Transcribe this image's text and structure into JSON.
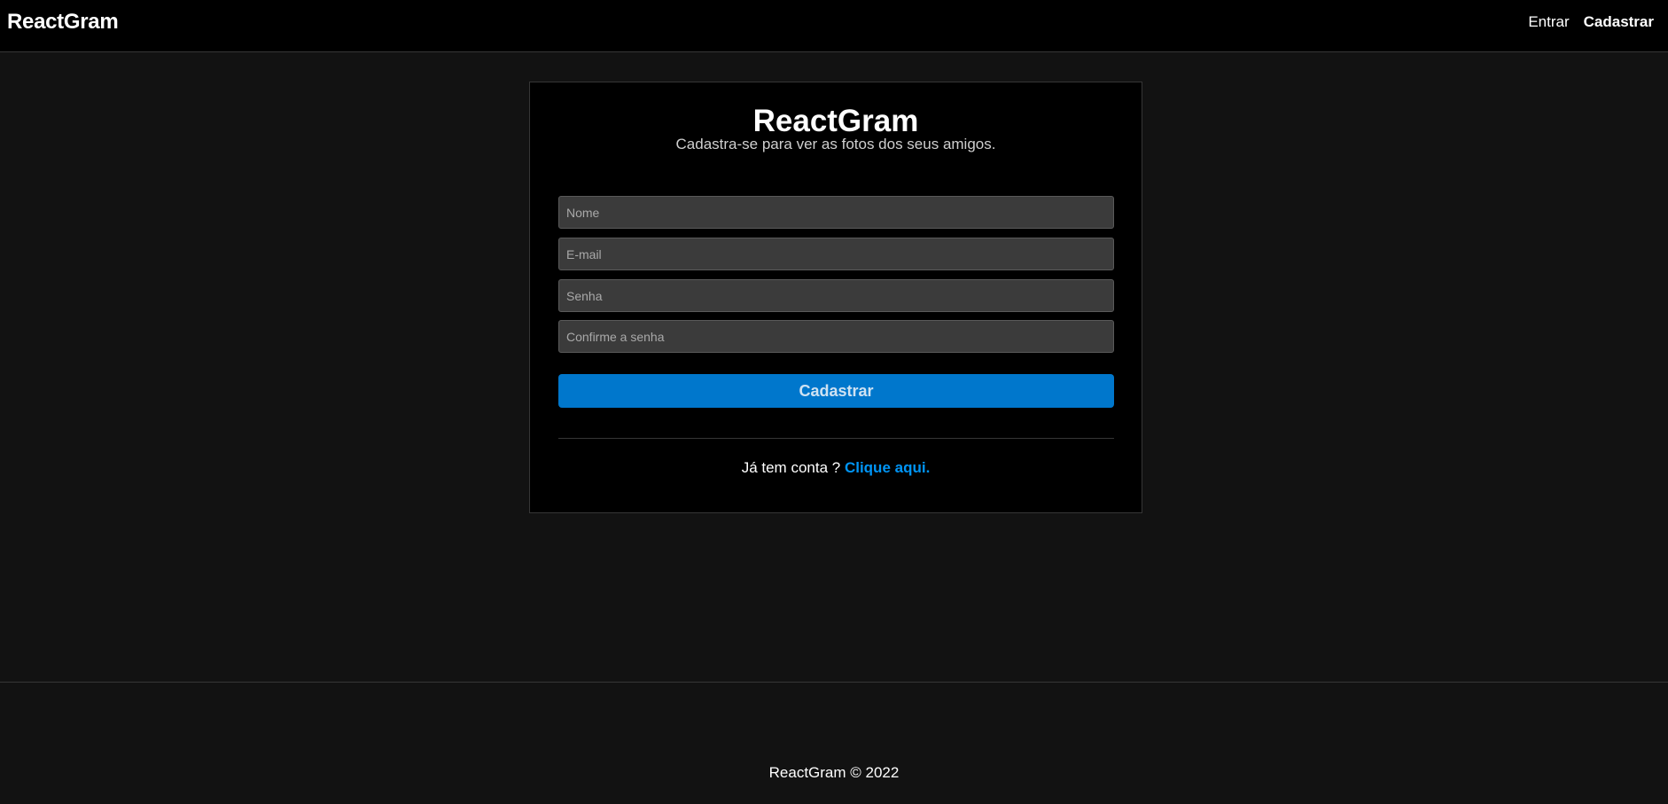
{
  "navbar": {
    "brand": "ReactGram",
    "links": [
      {
        "label": "Entrar",
        "active": false
      },
      {
        "label": "Cadastrar",
        "active": true
      }
    ]
  },
  "register": {
    "title": "ReactGram",
    "subtitle": "Cadastra-se para ver as fotos dos seus amigos.",
    "fields": {
      "name_placeholder": "Nome",
      "email_placeholder": "E-mail",
      "password_placeholder": "Senha",
      "confirm_placeholder": "Confirme a senha"
    },
    "submit_label": "Cadastrar",
    "login_prompt": "Já tem conta ?",
    "login_link": "Clique aqui."
  },
  "footer": {
    "text": "ReactGram © 2022"
  },
  "colors": {
    "background": "#121212",
    "surface": "#000000",
    "input": "#3b3b3b",
    "primary_button": "#0077cc",
    "link": "#0095f6"
  }
}
